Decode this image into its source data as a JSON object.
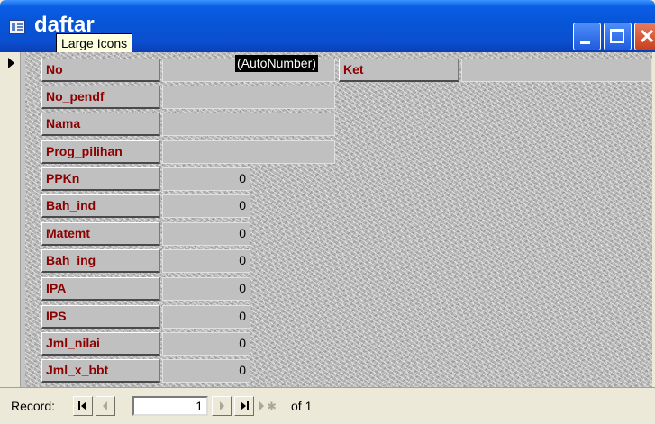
{
  "window": {
    "title": "daftar"
  },
  "tooltip": {
    "text": "Large Icons"
  },
  "form": {
    "fields": {
      "no": {
        "label": "No",
        "value": "(AutoNumber)"
      },
      "ket": {
        "label": "Ket",
        "value": ""
      },
      "no_pendf": {
        "label": "No_pendf",
        "value": ""
      },
      "nama": {
        "label": "Nama",
        "value": ""
      },
      "prog_pilihan": {
        "label": "Prog_pilihan",
        "value": ""
      },
      "ppkn": {
        "label": "PPKn",
        "value": "0"
      },
      "bah_ind": {
        "label": "Bah_ind",
        "value": "0"
      },
      "matemt": {
        "label": "Matemt",
        "value": "0"
      },
      "bah_ing": {
        "label": "Bah_ing",
        "value": "0"
      },
      "ipa": {
        "label": "IPA",
        "value": "0"
      },
      "ips": {
        "label": "IPS",
        "value": "0"
      },
      "jml_nilai": {
        "label": "Jml_nilai",
        "value": "0"
      },
      "jml_x_bbt": {
        "label": "Jml_x_bbt",
        "value": "0"
      }
    }
  },
  "navigation": {
    "record_label": "Record:",
    "current_record": "1",
    "of_label": "of  1"
  },
  "colors": {
    "title_bar": "#0754d6",
    "label_text": "#8b0000",
    "tooltip_bg": "#ffffe1"
  }
}
